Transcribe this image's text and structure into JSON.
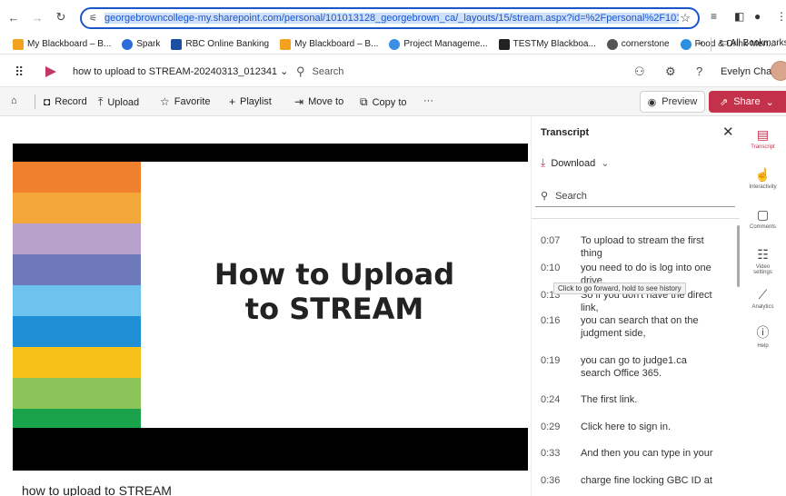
{
  "browser": {
    "url": "georgebrowncollege-my.sharepoint.com/personal/101013128_georgebrown_ca/_layouts/15/stream.aspx?id=%2Fpersonal%2F101013128_geo",
    "bookmarks": [
      {
        "label": "My Blackboard – B...",
        "color": "#f4a21e"
      },
      {
        "label": "Spark",
        "color": "#2b6cd8"
      },
      {
        "label": "RBC Online Banking",
        "color": "#1c4fa0"
      },
      {
        "label": "My Blackboard – B...",
        "color": "#f4a21e"
      },
      {
        "label": "Project Manageme...",
        "color": "#3a8ee6"
      },
      {
        "label": "TESTMy Blackboa...",
        "color": "#222222"
      },
      {
        "label": "cornerstone",
        "color": "#555555"
      },
      {
        "label": "Food & Drink Men...",
        "color": "#2c8fe0"
      }
    ],
    "more": "»",
    "all_bookmarks": "All Bookmarks"
  },
  "app": {
    "doc_title": "how to upload to STREAM-20240313_012341",
    "search_placeholder": "Search",
    "user_name": "Evelyn Chan"
  },
  "commands": {
    "record": "Record",
    "upload": "Upload",
    "favorite": "Favorite",
    "playlist": "Playlist",
    "move_to": "Move to",
    "copy_to": "Copy to",
    "more": "···",
    "preview": "Preview",
    "share": "Share"
  },
  "video": {
    "slide_title_line1": "How to Upload",
    "slide_title_line2": "to STREAM",
    "title": "how to upload to STREAM",
    "stripe_colors": [
      "#f07f2e",
      "#f5a83a",
      "#b7a2cc",
      "#6d79b8",
      "#6cc3ee",
      "#1f8fd6",
      "#f6c21a",
      "#8cc45a",
      "#1aa34a"
    ]
  },
  "transcript": {
    "heading": "Transcript",
    "download": "Download",
    "search_placeholder": "Search",
    "tooltip": "Click to go forward, hold to see history",
    "entries": [
      {
        "time": "0:07",
        "text": "To upload to stream the first thing"
      },
      {
        "time": "0:10",
        "text": "you need to do is log into one drive."
      },
      {
        "time": "0:13",
        "text": "So if you don't have the direct link,"
      },
      {
        "time": "0:16",
        "text": "you can search that on the judgment side,"
      },
      {
        "time": "0:19",
        "text": "you can go to judge1.ca search Office 365."
      },
      {
        "time": "0:24",
        "text": "The first link."
      },
      {
        "time": "0:29",
        "text": "Click here to sign in."
      },
      {
        "time": "0:33",
        "text": "And then you can type in your"
      },
      {
        "time": "0:36",
        "text": "charge fine locking GBC ID at"
      }
    ]
  },
  "rail": {
    "transcript": "Transcript",
    "interactivity": "Interactivity",
    "comments": "Comments",
    "video_settings_1": "Video",
    "video_settings_2": "settings",
    "analytics": "Analytics",
    "help": "Help"
  }
}
